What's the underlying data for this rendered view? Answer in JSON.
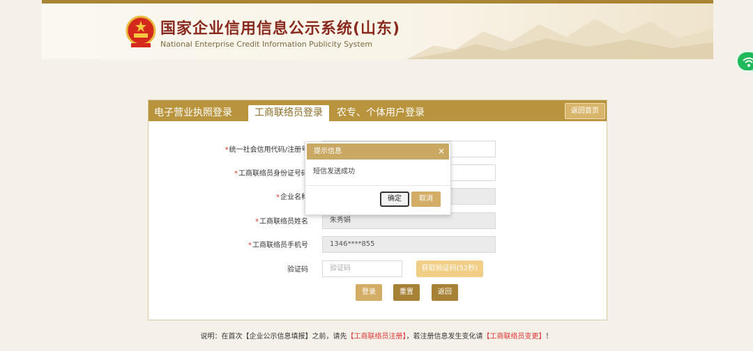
{
  "header": {
    "title_cn": "国家企业信用信息公示系统(山东)",
    "title_en": "National Enterprise Credit Information Publicity System"
  },
  "tabs": [
    {
      "label": "电子营业执照登录"
    },
    {
      "label": "工商联络员登录"
    },
    {
      "label": "农专、个体用户登录"
    }
  ],
  "back_home_label": "返回首页",
  "form": {
    "fields": [
      {
        "label": "统一社会信用代码/注册号",
        "value": ""
      },
      {
        "label": "工商联络员身份证号码",
        "value": ""
      },
      {
        "label": "企业名称",
        "value": ""
      },
      {
        "label": "工商联络员姓名",
        "value": "朱秀娟"
      },
      {
        "label": "工商联络员手机号",
        "value": "1346****855"
      }
    ],
    "code_label": "验证码",
    "code_placeholder": "验证码",
    "get_code_label": "获取验证码(52秒)",
    "login_label": "登录",
    "reset_label": "重置",
    "return_label": "返回"
  },
  "footnote": {
    "prefix": "说明：在首次【企业公示信息填报】之前，请先",
    "link1": "【工商联络员注册】",
    "middle": "，若注册信息发生变化请",
    "link2": "【工商联络员变更】",
    "suffix": "！"
  },
  "dialog": {
    "title": "提示信息",
    "message": "短信发送成功",
    "ok_label": "确定",
    "cancel_label": "取消"
  }
}
